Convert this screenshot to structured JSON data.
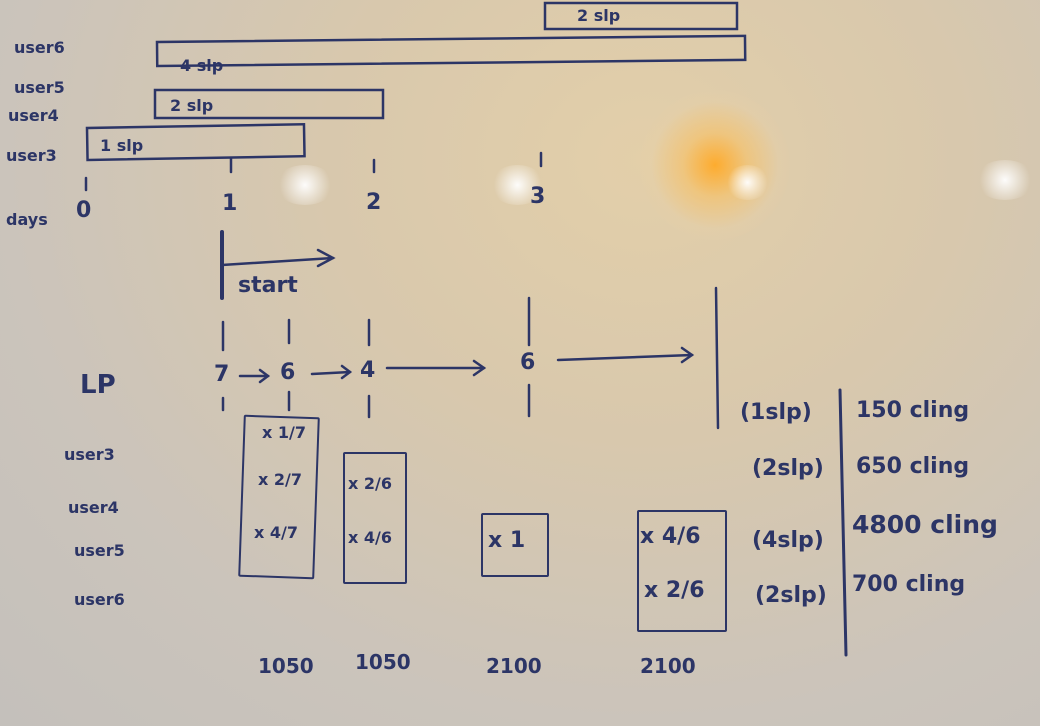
{
  "timeline": {
    "user_labels": [
      "user6",
      "user5",
      "user4",
      "user3"
    ],
    "axis_label": "days",
    "day_ticks": [
      "0",
      "1",
      "2",
      "3"
    ],
    "bars": {
      "top": "2 slp",
      "user5": "4 slp",
      "user4": "2 slp",
      "user3": "1 slp"
    },
    "start_label": "start"
  },
  "lp": {
    "label": "LP",
    "values": [
      "7",
      "6",
      "4",
      "6"
    ]
  },
  "rows": [
    "user3",
    "user4",
    "user5",
    "user6"
  ],
  "multipliers": {
    "col1": [
      "x 1/7",
      "x 2/7",
      "x 4/7"
    ],
    "col2": [
      "x 2/6",
      "x 4/6"
    ],
    "col3": [
      "x 1"
    ],
    "col4": [
      "x 4/6",
      "x 2/6"
    ]
  },
  "totals": [
    "1050",
    "1050",
    "2100",
    "2100"
  ],
  "legend": [
    {
      "stake": "(1slp)",
      "amount": "150 cling"
    },
    {
      "stake": "(2slp)",
      "amount": "650 cling"
    },
    {
      "stake": "(4slp)",
      "amount": "4800 cling"
    },
    {
      "stake": "(2slp)",
      "amount": "700 cling"
    }
  ]
}
